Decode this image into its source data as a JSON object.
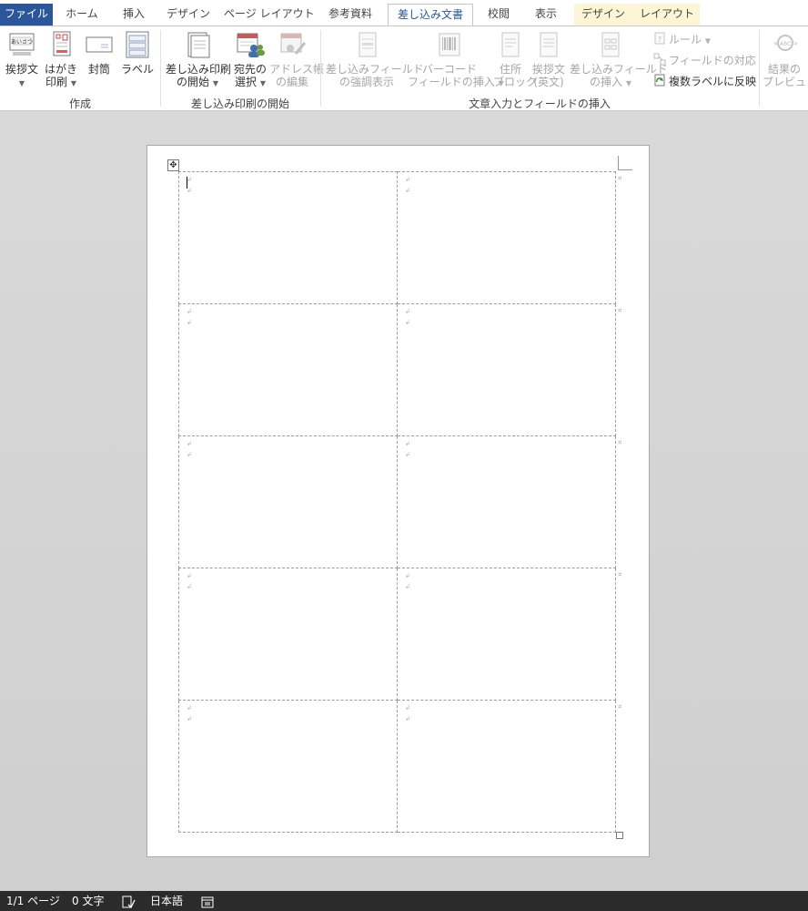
{
  "tabs": {
    "file": "ファイル",
    "home": "ホーム",
    "insert": "挿入",
    "design": "デザイン",
    "layout": "ページ レイアウト",
    "references": "参考資料",
    "mailings": "差し込み文書",
    "review": "校閲",
    "view": "表示",
    "table_design": "デザイン",
    "table_layout": "レイアウト"
  },
  "ribbon": {
    "create": {
      "greeting": "挨拶文",
      "postcard_line1": "はがき",
      "postcard_line2": "印刷",
      "envelope": "封筒",
      "labels": "ラベル",
      "group_label": "作成"
    },
    "start": {
      "start_line1": "差し込み印刷",
      "start_line2": "の開始",
      "recipients_line1": "宛先の",
      "recipients_line2": "選択",
      "edit_line1": "アドレス帳",
      "edit_line2": "の編集",
      "group_label": "差し込み印刷の開始"
    },
    "fields": {
      "highlight_line1": "差し込みフィールド",
      "highlight_line2": "の強調表示",
      "barcode_line1": "バーコード",
      "barcode_line2": "フィールドの挿入",
      "address_line1": "住所",
      "address_line2": "ブロック",
      "greet_en_line1": "挨拶文",
      "greet_en_line2": "(英文)",
      "insert_field_line1": "差し込みフィールド",
      "insert_field_line2": "の挿入",
      "rules": "ルール",
      "match_fields": "フィールドの対応",
      "update_labels": "複数ラベルに反映",
      "group_label": "文章入力とフィールドの挿入"
    },
    "preview": {
      "preview_line1": "結果の",
      "preview_line2": "プレビュー"
    }
  },
  "table": {
    "rows": 5,
    "cols": 2,
    "para_mark": "↲",
    "cell_mark": "¤"
  },
  "status": {
    "page": "1/1 ページ",
    "words": "0 文字",
    "language": "日本語"
  }
}
